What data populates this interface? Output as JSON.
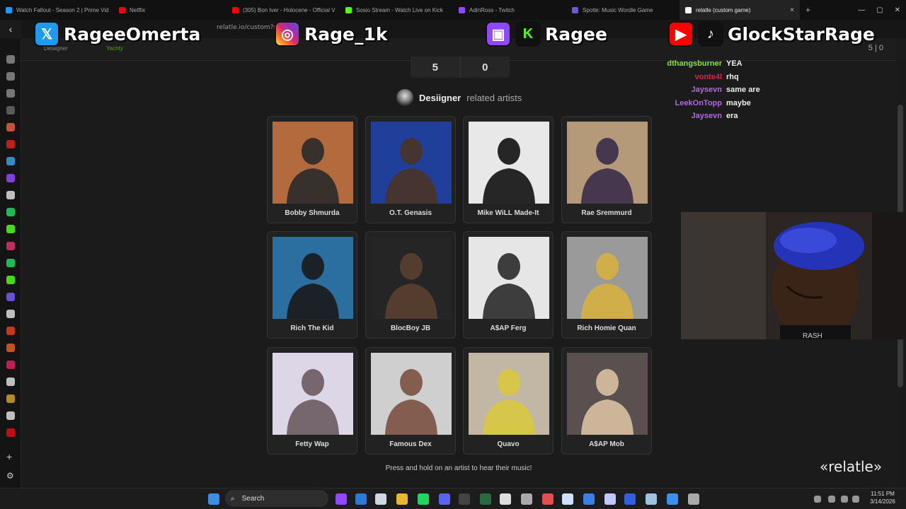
{
  "browser": {
    "tabs": [
      {
        "title": "Watch Fallout - Season 2 | Prime Vid",
        "color": "#1a98ff"
      },
      {
        "title": "Netflix",
        "color": "#e50914"
      },
      {
        "title": "(305) Bon Iver - Holocene - Official V",
        "color": "#ff0000"
      },
      {
        "title": "Sosio Stream - Watch Live on Kick",
        "color": "#53fc18"
      },
      {
        "title": "AdinRoss - Twitch",
        "color": "#9146ff"
      },
      {
        "title": "Spotle: Music Wordle Game",
        "color": "#6b5bd2"
      },
      {
        "title": "relatle (custom game)",
        "color": "#ffffff"
      }
    ],
    "close_tab": "×",
    "new_tab": "+",
    "url": "relatle.io/custom?s"
  },
  "game": {
    "score_left": "5",
    "score_right": "0",
    "score_corner": "5 | 0",
    "artist": "Desiigner",
    "related_suffix": "related artists",
    "footer_note": "Press and hold on an artist to hear their music!",
    "brand": "«relatle»",
    "artists": [
      {
        "name": "Bobby Shmurda",
        "bg": "#b36a3c",
        "fg": "#2a2a2a"
      },
      {
        "name": "O.T. Genasis",
        "bg": "#1f3f9a",
        "fg": "#4a3326"
      },
      {
        "name": "Mike WiLL Made-It",
        "bg": "#e8e8e8",
        "fg": "#111111"
      },
      {
        "name": "Rae Sremmurd",
        "bg": "#b49a78",
        "fg": "#3a2c4a"
      },
      {
        "name": "Rich The Kid",
        "bg": "#2a6fa0",
        "fg": "#1a1a1a"
      },
      {
        "name": "BlocBoy JB",
        "bg": "#252525",
        "fg": "#5a4030"
      },
      {
        "name": "A$AP Ferg",
        "bg": "#e6e6e6",
        "fg": "#2a2a2a"
      },
      {
        "name": "Rich Homie Quan",
        "bg": "#9a9a9a",
        "fg": "#d6b040"
      },
      {
        "name": "Fetty Wap",
        "bg": "#ddd6e6",
        "fg": "#6a5a60"
      },
      {
        "name": "Famous Dex",
        "bg": "#cfcfcf",
        "fg": "#7a5040"
      },
      {
        "name": "Quavo",
        "bg": "#c2b6a4",
        "fg": "#d8c840"
      },
      {
        "name": "A$AP Mob",
        "bg": "#5a5050",
        "fg": "#d8c0a0"
      }
    ]
  },
  "chat": [
    {
      "user": "dthangsburner",
      "msg": "YEA",
      "color": "#8be04a"
    },
    {
      "user": "vonte4l",
      "msg": "rhq",
      "color": "#e0204a"
    },
    {
      "user": "Jaysevn",
      "msg": "same are",
      "color": "#b06ae0"
    },
    {
      "user": "LeekOnTopp",
      "msg": "maybe",
      "color": "#b06ae0"
    },
    {
      "user": "Jaysevn",
      "msg": "era",
      "color": "#b06ae0"
    }
  ],
  "overlay": {
    "x_handle": "RageeOmerta",
    "ig_handle": "Rage_1k",
    "twitch_kick_handle": "Ragee",
    "yt_tiktok_handle": "GlockStarRage",
    "x_icon": "x-logo-icon",
    "ig_icon": "instagram-icon",
    "twitch_icon": "twitch-icon",
    "kick_icon": "kick-icon",
    "yt_icon": "youtube-icon",
    "tiktok_icon": "tiktok-icon"
  },
  "subheader": {
    "artist_label": "Desiigner",
    "guess_label": "Yachty"
  },
  "taskbar": {
    "search_placeholder": "Search",
    "time": "11:51 PM",
    "date": "3/14/2026"
  }
}
